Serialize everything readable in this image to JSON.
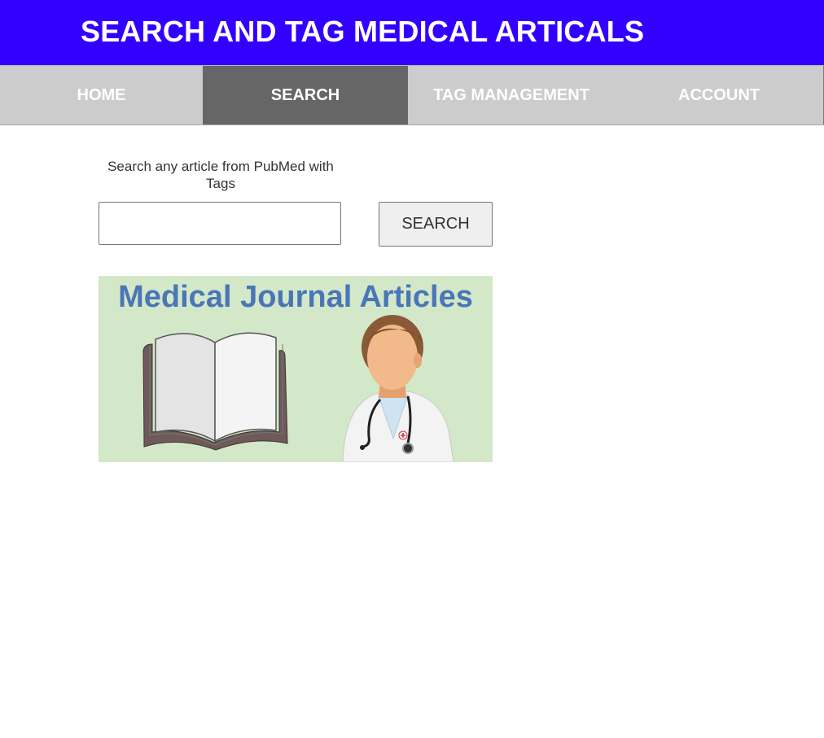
{
  "header": {
    "title": "SEARCH AND TAG MEDICAL ARTICALS",
    "background_color": "#3300ff"
  },
  "nav": {
    "items": [
      {
        "label": "HOME",
        "active": false
      },
      {
        "label": "SEARCH",
        "active": true
      },
      {
        "label": "TAG MANAGEMENT",
        "active": false
      },
      {
        "label": "ACCOUNT",
        "active": false
      }
    ],
    "background_color": "#cccccc",
    "active_color": "#666666"
  },
  "search": {
    "caption": "Search any article from PubMed with Tags",
    "input_value": "",
    "button_label": "SEARCH"
  },
  "banner": {
    "title": "Medical Journal Articles",
    "background_color": "#d3e8c8",
    "title_color": "#4a76b8",
    "icons": [
      "open-book-icon",
      "doctor-icon"
    ]
  }
}
